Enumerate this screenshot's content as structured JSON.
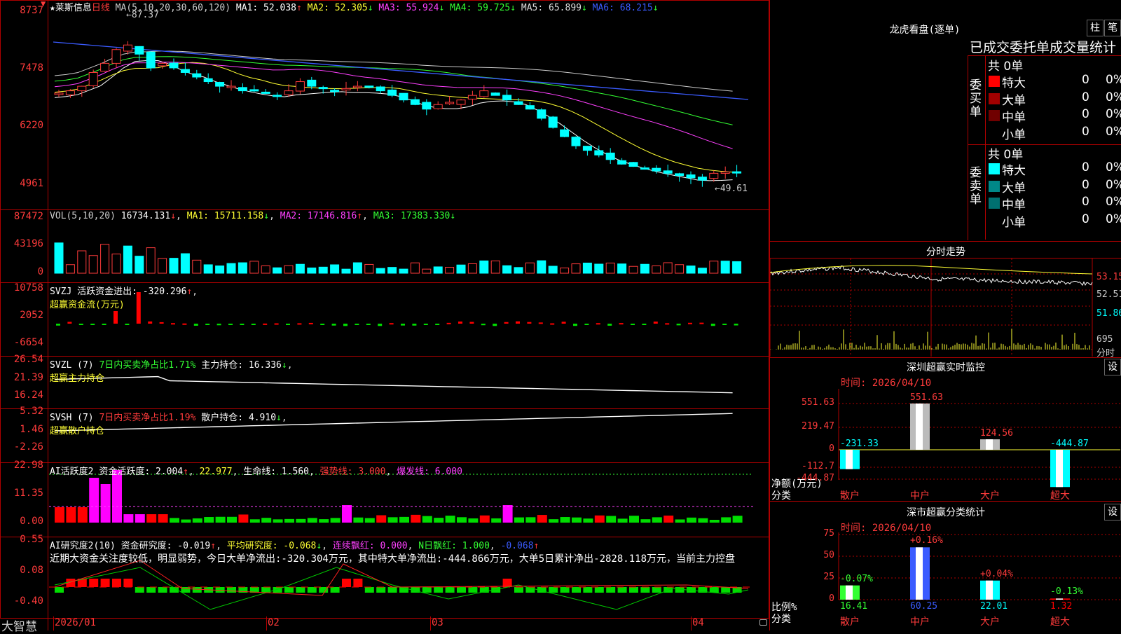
{
  "stock": {
    "name": "★莱斯信息",
    "period": "日线"
  },
  "price_panel": {
    "ma_header": "MA(5,10,20,30,60,120)",
    "mas": [
      {
        "label": "MA1: 52.038",
        "arrow": "↑",
        "color": "#ffffff"
      },
      {
        "label": "MA2: 52.305",
        "arrow": "↓",
        "color": "#ffff33"
      },
      {
        "label": "MA3: 55.924",
        "arrow": "↓",
        "color": "#ff40ff"
      },
      {
        "label": "MA4: 59.725",
        "arrow": "↓",
        "color": "#33ff33"
      },
      {
        "label": "MA5: 65.899",
        "arrow": "↓",
        "color": "#dddddd"
      },
      {
        "label": "MA6: 68.215",
        "arrow": "↓",
        "color": "#3a5bff"
      }
    ],
    "y_ticks": [
      "8737",
      "7478",
      "6220",
      "4961"
    ],
    "high_label": "87.37",
    "low_label": "49.61"
  },
  "vol_panel": {
    "header": "VOL(5,10,20)",
    "value": "16734.131",
    "ma1": "MA1: 15711.158",
    "ma2": "MA2: 17146.816",
    "ma3": "MA3: 17383.330",
    "y_ticks": [
      "87472",
      "43196",
      "0"
    ]
  },
  "svzj_panel": {
    "line1": "SVZJ  活跃资金进出: -320.296",
    "line2": "超赢资金流(万元)",
    "y_ticks": [
      "10758",
      "2052",
      "-6654"
    ]
  },
  "svzl_panel": {
    "name": "SVZL (7)",
    "ratio": "7日内买卖净占比1.71%",
    "hold": "主力持仓: 16.336",
    "line2": "超赢主力持仓",
    "y_ticks": [
      "26.54",
      "21.39",
      "16.24"
    ]
  },
  "svsh_panel": {
    "name": "SVSH (7)",
    "ratio": "7日内买卖净占比1.19%",
    "hold": "散户持仓: 4.910",
    "line2": "超赢散户持仓",
    "y_ticks": [
      "5.32",
      "1.46",
      "-2.26"
    ]
  },
  "ai_active": {
    "name": "AI活跃度2",
    "a1": "资金活跃度: 2.004",
    "a2": "22.977",
    "a3": "生命线: 1.560",
    "a4": "强势线: 3.000",
    "a5": "爆发线: 6.000",
    "y_ticks": [
      "22.98",
      "11.35",
      "0.00"
    ]
  },
  "ai_research": {
    "name": "AI研究度2(10)",
    "r1": "资金研究度: -0.019",
    "r2": "平均研究度: -0.068",
    "r3": "连续飘红: 0.000",
    "r4": "N日飘红: 1.000",
    "r5": "-0.068",
    "note": "近期大资金关注度较低，明显弱势，今日大单净流出:-320.304万元，其中特大单净流出:-444.866万元，大单5日累计净出-2828.118万元，当前主力控盘",
    "y_ticks": [
      "0.55",
      "0.08",
      "-0.40"
    ]
  },
  "bottom": {
    "brand": "大智慧",
    "dates": [
      "2026/01",
      "02",
      "03",
      "04"
    ]
  },
  "right": {
    "lhb_title": "龙虎看盘(逐单)",
    "btn1": "柱",
    "btn2": "笔",
    "stat_title": "已成交委托单成交量统计",
    "buy_label": "委买单",
    "sell_label": "委卖单",
    "buy_total": "共 0单",
    "sell_total": "共 0单",
    "buy_rows": [
      {
        "name": "特大",
        "n": "0",
        "p": "0%",
        "color": "#ff0000"
      },
      {
        "name": "大单",
        "n": "0",
        "p": "0%",
        "color": "#a00000"
      },
      {
        "name": "中单",
        "n": "0",
        "p": "0%",
        "color": "#700000"
      },
      {
        "name": "小单",
        "n": "0",
        "p": "0%",
        "color": "#000000"
      }
    ],
    "sell_rows": [
      {
        "name": "特大",
        "n": "0",
        "p": "0%",
        "color": "#00ffff"
      },
      {
        "name": "大单",
        "n": "0",
        "p": "0%",
        "color": "#008888"
      },
      {
        "name": "中单",
        "n": "0",
        "p": "0%",
        "color": "#007070"
      },
      {
        "name": "小单",
        "n": "0",
        "p": "0%",
        "color": "#000000"
      }
    ],
    "fs_title": "分时走势",
    "fs_ticks": [
      "53.15",
      "52.51",
      "51.86"
    ],
    "fs_vol": "695",
    "fs_vol_unit": "分时",
    "sz_title": "深圳超赢实时监控",
    "sz_set": "设",
    "sz_time": "时间: 2026/04/10",
    "sz_ticks": [
      "551.63",
      "219.47",
      "0",
      "-112.7",
      "-444.87"
    ],
    "sz_unit": "净额(万元)",
    "sz_cat": "分类",
    "sz_bars": [
      {
        "cat": "散户",
        "val": "-231.33"
      },
      {
        "cat": "中户",
        "val": "551.63"
      },
      {
        "cat": "大户",
        "val": "124.56"
      },
      {
        "cat": "超大",
        "val": "-444.87"
      }
    ],
    "ss_title": "深市超赢分类统计",
    "ss_set": "设",
    "ss_time": "时间: 2026/04/10",
    "ss_ticks": [
      "75",
      "50",
      "25",
      "0"
    ],
    "ss_unit": "比例%",
    "ss_cat": "分类",
    "ss_bars": [
      {
        "cat": "散户",
        "pct": "16.41",
        "chg": "-0.07%"
      },
      {
        "cat": "中户",
        "pct": "60.25",
        "chg": "+0.16%"
      },
      {
        "cat": "大户",
        "pct": "22.01",
        "chg": "+0.04%"
      },
      {
        "cat": "超大",
        "pct": "1.32",
        "chg": "-0.13%"
      }
    ]
  }
}
